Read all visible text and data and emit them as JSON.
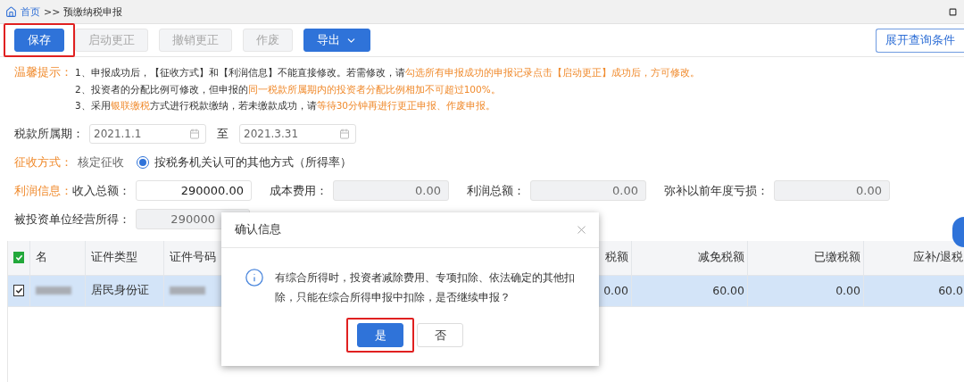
{
  "breadcrumb": {
    "home": "首页",
    "separator": ">>",
    "current": "预缴纳税申报"
  },
  "toolbar": {
    "buttons": [
      {
        "label": "保存",
        "kind": "primary",
        "disabled": false,
        "highlighted": true
      },
      {
        "label": "启动更正",
        "kind": "default",
        "disabled": true,
        "highlighted": false
      },
      {
        "label": "撤销更正",
        "kind": "default",
        "disabled": true,
        "highlighted": false
      },
      {
        "label": "作废",
        "kind": "default",
        "disabled": true,
        "highlighted": false
      },
      {
        "label": "导出",
        "kind": "dropdown",
        "disabled": false,
        "highlighted": false
      }
    ],
    "expand_button": "展开查询条件"
  },
  "notice": {
    "label": "温馨提示：",
    "lines": [
      [
        {
          "text": "1、申报成功后，【征收方式】和【利润信息】不能直接修改。若需修改，请",
          "highlight": false
        },
        {
          "text": "勾选所有申报成功的申报记录点击【启动更正】成功后，方可修改。",
          "highlight": true
        }
      ],
      [
        {
          "text": "2、投资者的分配比例可修改，但申报的",
          "highlight": false
        },
        {
          "text": "同一税款所属期内的投资者分配比例相加不可超过100%。",
          "highlight": true
        }
      ],
      [
        {
          "text": "3、采用",
          "highlight": false
        },
        {
          "text": "银联缴税",
          "highlight": true
        },
        {
          "text": "方式进行税款缴纳，若未缴款成功，请",
          "highlight": false
        },
        {
          "text": "等待30分钟再进行更正申报、作废申报。",
          "highlight": true
        }
      ]
    ]
  },
  "period": {
    "label": "税款所属期：",
    "from": "2021.1.1",
    "to_label": "至",
    "to": "2021.3.31"
  },
  "collection": {
    "label": "征收方式：",
    "method": "核定征收",
    "options": [
      {
        "label": "按税务机关认可的其他方式（所得率）",
        "selected": true
      }
    ]
  },
  "profit": {
    "label": "利润信息：",
    "fields": [
      {
        "label": "收入总额：",
        "value": "290000.00",
        "disabled": false
      },
      {
        "label": "成本费用：",
        "value": "0.00",
        "disabled": true
      },
      {
        "label": "利润总额：",
        "value": "0.00",
        "disabled": true
      },
      {
        "label": "弥补以前年度亏损：",
        "value": "0.00",
        "disabled": true
      }
    ]
  },
  "operating_income": {
    "label": "被投资单位经营所得：",
    "value": "290000",
    "disabled": true
  },
  "table": {
    "all_checked": true,
    "columns": [
      {
        "label": "名",
        "kind": "text"
      },
      {
        "label": "证件类型",
        "kind": "text"
      },
      {
        "label": "证件号码",
        "kind": "text"
      },
      {
        "label": "税额",
        "kind": "number"
      },
      {
        "label": "减免税额",
        "kind": "number"
      },
      {
        "label": "已缴税额",
        "kind": "number"
      },
      {
        "label": "应补/退税",
        "kind": "number"
      }
    ],
    "rows": [
      {
        "checked": true,
        "selected": true,
        "cells": [
          {
            "kind": "blurred"
          },
          {
            "kind": "text",
            "text": "居民身份证"
          },
          {
            "kind": "blurred"
          },
          {
            "kind": "text",
            "text": "0.00"
          },
          {
            "kind": "text",
            "text": "60.00"
          },
          {
            "kind": "text",
            "text": "0.00"
          },
          {
            "kind": "text",
            "text": "60.0"
          }
        ]
      }
    ]
  },
  "dialog": {
    "title": "确认信息",
    "message": "有综合所得时，投资者减除费用、专项扣除、依法确定的其他扣除，只能在综合所得申报中扣除，是否继续申报？",
    "buttons": [
      {
        "label": "是",
        "kind": "primary",
        "highlighted": true
      },
      {
        "label": "否",
        "kind": "default",
        "highlighted": false
      }
    ]
  }
}
